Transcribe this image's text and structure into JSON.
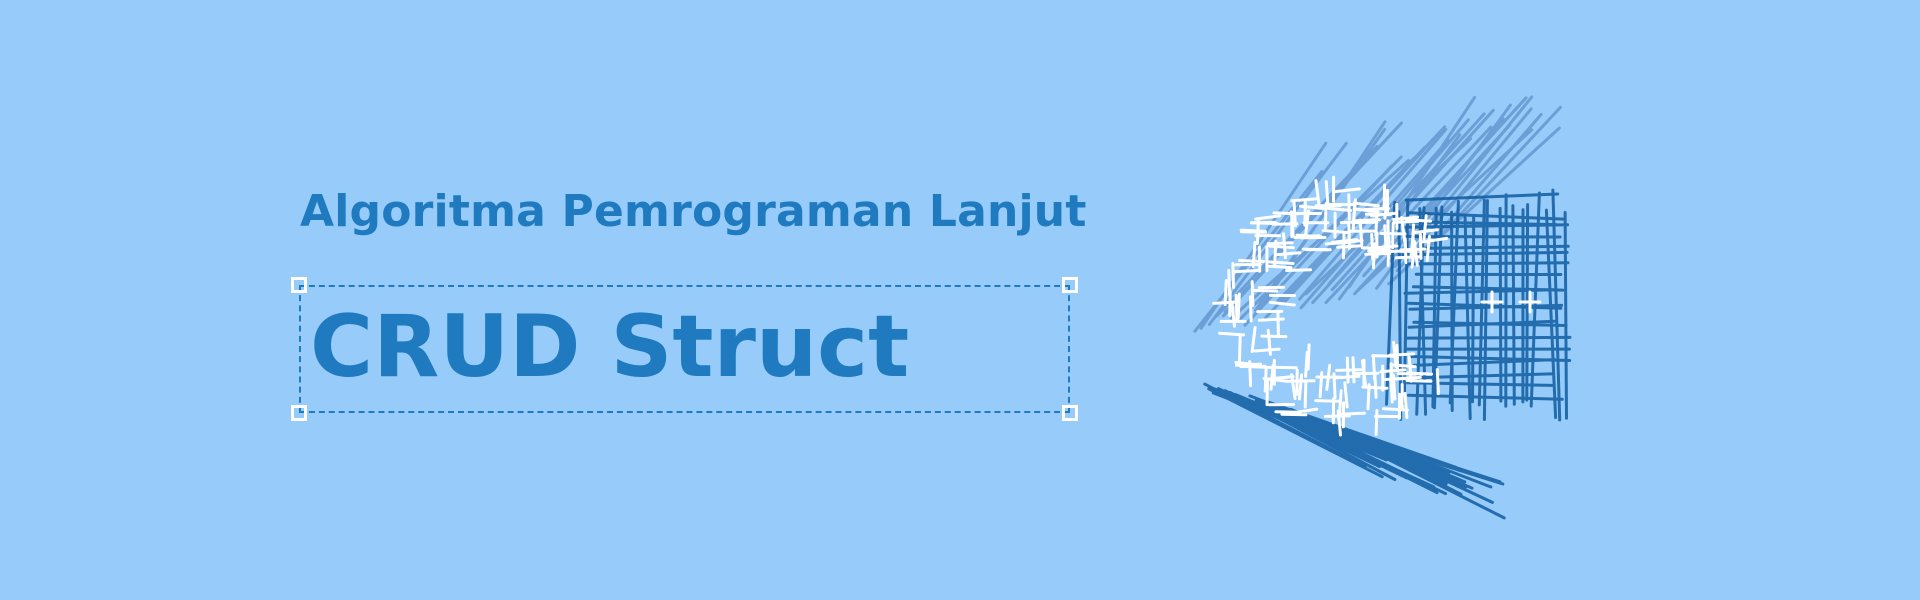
{
  "banner": {
    "subtitle": "Algoritma Pemrograman Lanjut",
    "title": "CRUD Struct",
    "logo_icon": "c-language-logo-sketch",
    "colors": {
      "background": "#97cbfa",
      "text": "#1f7abf",
      "logo_light": "#5e91c9",
      "logo_dark": "#0f5ca0",
      "logo_white": "#ffffff"
    }
  }
}
